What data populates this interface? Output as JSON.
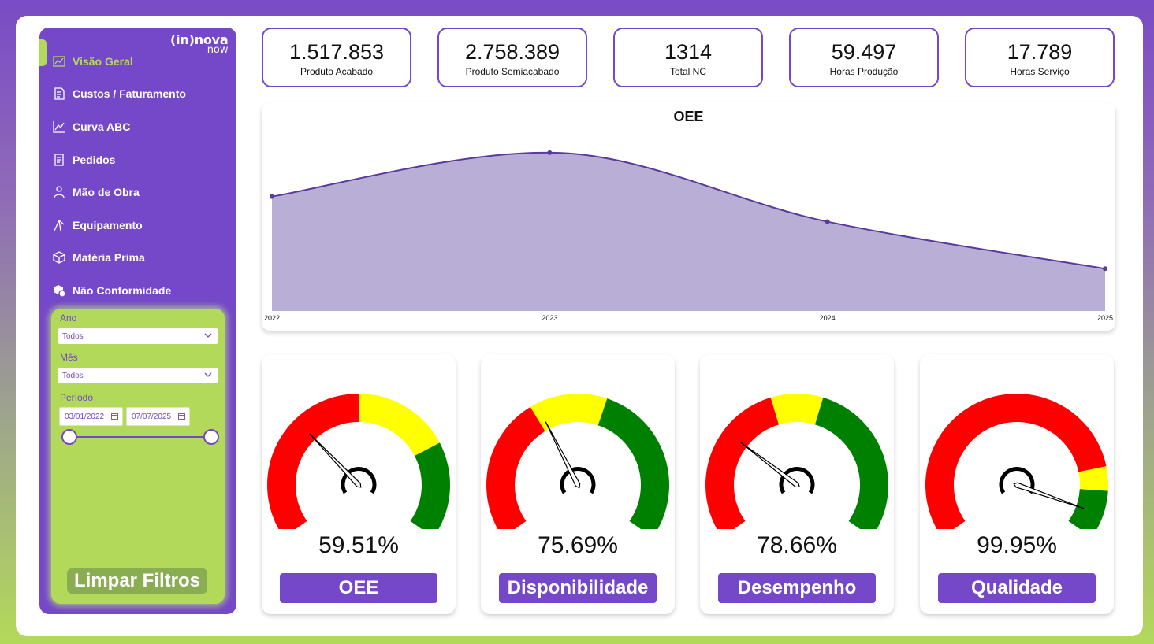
{
  "logo": {
    "line1": "(in)nova",
    "line2": "now"
  },
  "nav": [
    {
      "label": "Visão Geral",
      "icon": "dashboard-icon",
      "active": true
    },
    {
      "label": "Custos / Faturamento",
      "icon": "invoice-icon"
    },
    {
      "label": "Curva ABC",
      "icon": "line-chart-icon"
    },
    {
      "label": "Pedidos",
      "icon": "order-icon"
    },
    {
      "label": "Mão de Obra",
      "icon": "worker-icon"
    },
    {
      "label": "Equipamento",
      "icon": "crane-icon"
    },
    {
      "label": "Matéria Prima",
      "icon": "box-icon"
    },
    {
      "label": "Não Conformidade",
      "icon": "defect-box-icon"
    }
  ],
  "filters": {
    "ano_label": "Ano",
    "ano_value": "Todos",
    "mes_label": "Mês",
    "mes_value": "Todos",
    "periodo_label": "Período",
    "date_start": "03/01/2022",
    "date_end": "07/07/2025",
    "clear_label": "Limpar Filtros"
  },
  "kpis": [
    {
      "value": "1.517.853",
      "label": "Produto Acabado"
    },
    {
      "value": "2.758.389",
      "label": "Produto Semiacabado"
    },
    {
      "value": "1314",
      "label": "Total NC"
    },
    {
      "value": "59.497",
      "label": "Horas Produção"
    },
    {
      "value": "17.789",
      "label": "Horas Serviço"
    }
  ],
  "chart_data": {
    "type": "area",
    "title": "OEE",
    "x": [
      "2022",
      "2023",
      "2024",
      "2025"
    ],
    "series": [
      {
        "values": [
          60,
          74,
          52,
          37
        ]
      }
    ],
    "ylim": [
      18,
      80
    ],
    "grid": false,
    "colors": {
      "line": "#5b3a9e",
      "fill": "#b8aed6"
    }
  },
  "gauges": [
    {
      "label": "OEE",
      "value_text": "59.51%",
      "value": 59.51,
      "zones": [
        {
          "to": 70,
          "color": "#ff0000"
        },
        {
          "to": 85,
          "color": "#ffff00"
        },
        {
          "to": 100,
          "color": "#008000"
        }
      ],
      "min": 40,
      "max": 100
    },
    {
      "label": "Disponibilidade",
      "value_text": "75.69%",
      "value": 75.69,
      "zones": [
        {
          "to": 75,
          "color": "#ff0000"
        },
        {
          "to": 83,
          "color": "#ffff00"
        },
        {
          "to": 100,
          "color": "#008000"
        }
      ],
      "min": 60,
      "max": 100
    },
    {
      "label": "Desempenho",
      "value_text": "78.66%",
      "value": 78.66,
      "zones": [
        {
          "to": 83,
          "color": "#ff0000"
        },
        {
          "to": 87,
          "color": "#ffff00"
        },
        {
          "to": 100,
          "color": "#008000"
        }
      ],
      "min": 70,
      "max": 100
    },
    {
      "label": "Qualidade",
      "value_text": "99.95%",
      "value": 99.95,
      "zones": [
        {
          "to": 99.85,
          "color": "#ff0000"
        },
        {
          "to": 99.9,
          "color": "#ffff00"
        },
        {
          "to": 100,
          "color": "#008000"
        }
      ],
      "min": 99.2,
      "max": 100
    }
  ],
  "colors": {
    "primary": "#7448c8",
    "accent": "#b3d95a",
    "chart_line": "#5b3a9e",
    "chart_fill": "#b8aed6"
  }
}
